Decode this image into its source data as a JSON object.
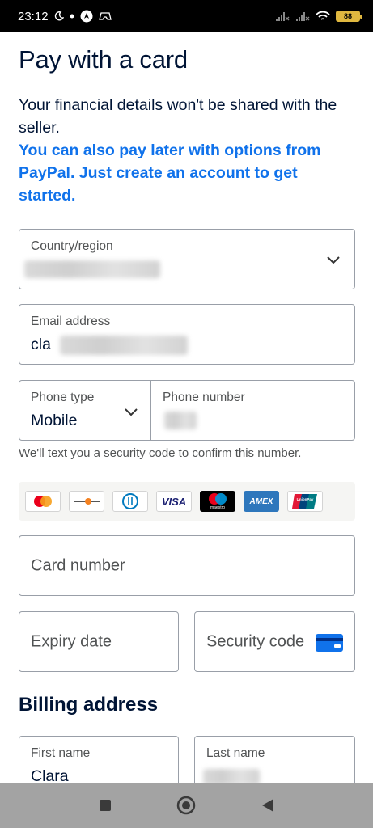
{
  "status_bar": {
    "time": "23:12",
    "battery_level": "88",
    "icons": [
      "moon-icon",
      "dot-icon",
      "navigation-icon",
      "game-icon",
      "signal-x-icon",
      "signal-x-icon",
      "wifi-icon",
      "battery-icon"
    ]
  },
  "page": {
    "title": "Pay with a card",
    "info": "Your financial details won't be shared with the seller.",
    "pay_later_link": "You can also pay later with options from PayPal. Just create an account to get started."
  },
  "form": {
    "country": {
      "label": "Country/region",
      "value": ""
    },
    "email": {
      "label": "Email address",
      "value_visible": "cla"
    },
    "phone_type": {
      "label": "Phone type",
      "value": "Mobile"
    },
    "phone_number": {
      "label": "Phone number",
      "value": ""
    },
    "phone_hint": "We'll text you a security code to confirm this number.",
    "card_number": {
      "placeholder": "Card number"
    },
    "expiry": {
      "placeholder": "Expiry date"
    },
    "security_code": {
      "placeholder": "Security code"
    }
  },
  "card_brands": {
    "visa": "VISA",
    "maestro": "maestro",
    "amex": "AMEX",
    "unionpay": "UnionPay"
  },
  "billing": {
    "title": "Billing address",
    "first_name": {
      "label": "First name",
      "value": "Clara"
    },
    "last_name": {
      "label": "Last name",
      "value": ""
    }
  },
  "colors": {
    "text": "#001435",
    "link": "#1072eb",
    "border": "#999fa8",
    "nav_bar": "#a3a3a3"
  },
  "nav_bar": {
    "buttons": [
      "recents-square-icon",
      "home-circle-icon",
      "back-triangle-icon"
    ]
  }
}
